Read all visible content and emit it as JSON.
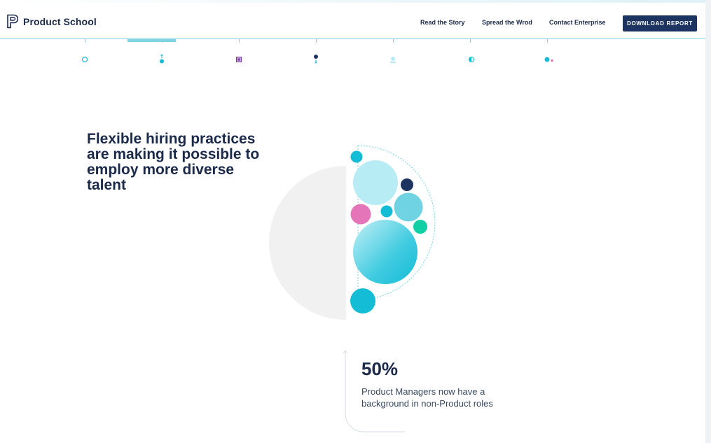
{
  "brand": {
    "name": "Product School",
    "icon": "product-school-logo-icon"
  },
  "nav": {
    "items": [
      {
        "label": "Read the Story"
      },
      {
        "label": "Spread the Wrod"
      },
      {
        "label": "Contact Enterprise"
      }
    ],
    "cta_label": "DOWNLOAD REPORT"
  },
  "progress": {
    "steps": [
      {
        "icon": "ring-icon"
      },
      {
        "icon": "dot-arrow-up-icon",
        "active": true
      },
      {
        "icon": "square-icon"
      },
      {
        "icon": "dot-arrow-down-icon"
      },
      {
        "icon": "dot-underline-icon"
      },
      {
        "icon": "half-circle-icon"
      },
      {
        "icon": "two-dots-icon"
      }
    ]
  },
  "section": {
    "headline": "Flexible hiring practices are making it possible to employ more diverse talent",
    "stat_value": "50%",
    "stat_description": "Product Managers now have a background in non-Product roles"
  },
  "colors": {
    "navy": "#1d3461",
    "teal": "#14bcd6",
    "light_teal": "#b7ecf4",
    "mid_teal": "#6fd3e2",
    "pink": "#e475b8",
    "green": "#11cfa5",
    "gray": "#f1f1f1"
  }
}
